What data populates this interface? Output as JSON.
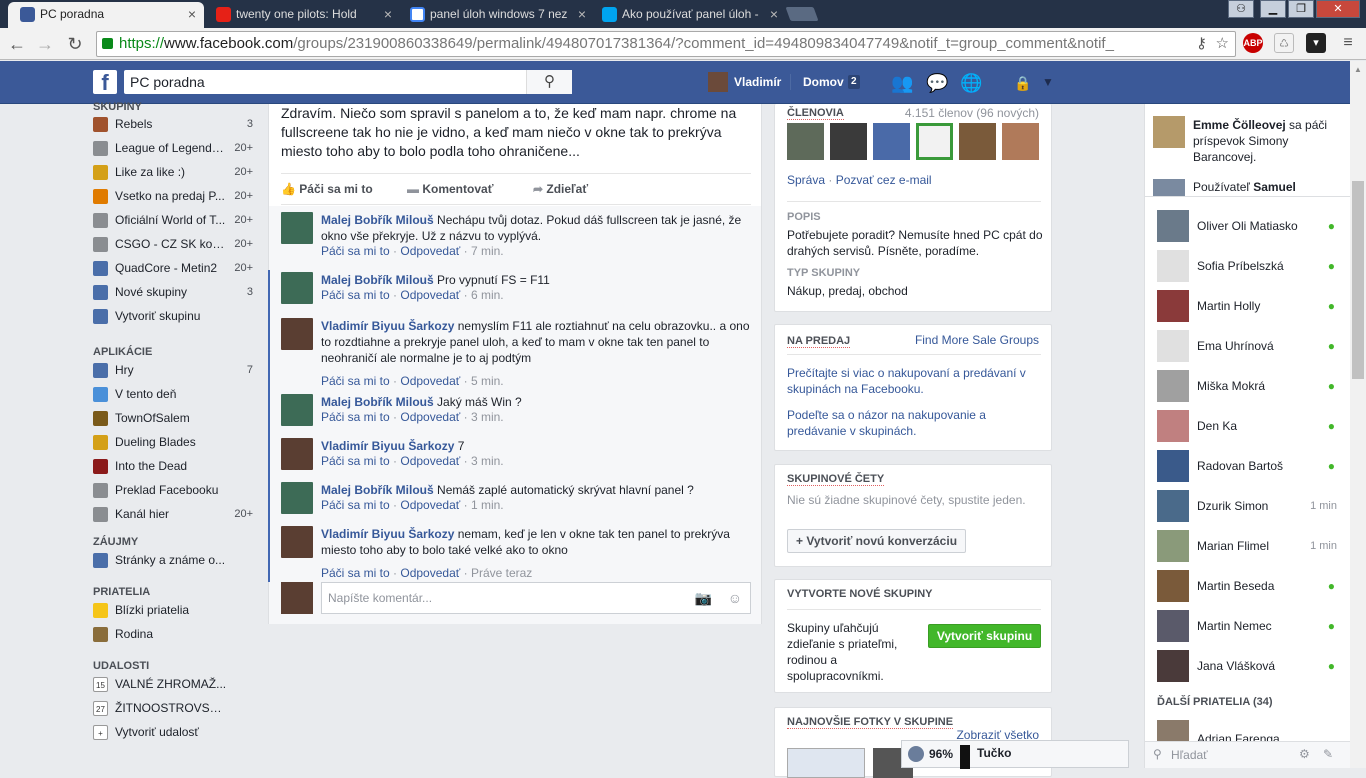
{
  "browser": {
    "tabs": [
      {
        "title": "PC poradna",
        "color": "#3b5998"
      },
      {
        "title": "twenty one pilots: Hold",
        "color": "#e62117"
      },
      {
        "title": "panel úloh windows 7 nez",
        "color": "#4285f4"
      },
      {
        "title": "Ako používať panel úloh -",
        "color": "#00a4ef"
      }
    ],
    "url_https": "https://",
    "url_host": "www.facebook.com",
    "url_rest": "/groups/231900860338649/permalink/494807017381364/?comment_id=494809834047749&notif_t=group_comment&notif_"
  },
  "fb": {
    "search_value": "PC poradna",
    "user": "Vladimír",
    "home": "Domov",
    "home_count": "2"
  },
  "left": {
    "groups_header": "SKUPINY",
    "groups": [
      {
        "label": "Rebels",
        "count": "3",
        "color": "#a0522d"
      },
      {
        "label": "League of Legends...",
        "count": "20+",
        "color": "#8a8d91"
      },
      {
        "label": "Like za like :)",
        "count": "20+",
        "color": "#d4a017"
      },
      {
        "label": "Vsetko na predaj P...",
        "count": "20+",
        "color": "#e07b00"
      },
      {
        "label": "Oficiální World of T...",
        "count": "20+",
        "color": "#8a8d91"
      },
      {
        "label": "CSGO - CZ SK kom...",
        "count": "20+",
        "color": "#8a8d91"
      },
      {
        "label": "QuadCore - Metin2",
        "count": "20+",
        "color": "#4a6ea9"
      },
      {
        "label": "Nové skupiny",
        "count": "3",
        "color": "#4a6ea9"
      },
      {
        "label": "Vytvoriť skupinu",
        "count": "",
        "color": "#4a6ea9"
      }
    ],
    "apps_header": "APLIKÁCIE",
    "apps": [
      {
        "label": "Hry",
        "count": "7",
        "color": "#4a6ea9"
      },
      {
        "label": "V tento deň",
        "count": "",
        "color": "#4a90d9"
      },
      {
        "label": "TownOfSalem",
        "count": "",
        "color": "#7a5a1a"
      },
      {
        "label": "Dueling Blades",
        "count": "",
        "color": "#d4a017"
      },
      {
        "label": "Into the Dead",
        "count": "",
        "color": "#8b1a1a"
      },
      {
        "label": "Preklad Facebooku",
        "count": "",
        "color": "#8a8d91"
      },
      {
        "label": "Kanál hier",
        "count": "20+",
        "color": "#8a8d91"
      }
    ],
    "interests_header": "ZÁUJMY",
    "interests": [
      {
        "label": "Stránky a známe o...",
        "count": "",
        "color": "#4a6ea9"
      }
    ],
    "friends_header": "PRIATELIA",
    "friends": [
      {
        "label": "Blízki priatelia",
        "count": "",
        "color": "#f5c518"
      },
      {
        "label": "Rodina",
        "count": "",
        "color": "#8a6d3b"
      }
    ],
    "events_header": "UDALOSTI",
    "events": [
      {
        "label": "VALNÉ ZHROMAŽ...",
        "count": "",
        "color": "#ffffff",
        "day": "15"
      },
      {
        "label": "ŽITNOOSTROVSK...",
        "count": "",
        "color": "#ffffff",
        "day": "27"
      },
      {
        "label": "Vytvoriť udalosť",
        "count": "",
        "color": "#ffffff",
        "day": "+"
      }
    ]
  },
  "post": {
    "text": "Zdravím. Niečo som spravil s panelom a to, že keď mam napr. chrome na fullscreene tak ho nie je vidno, a keď mam niečo v okne tak to prekrýva miesto toho aby to bolo podla toho ohraničene...",
    "like": "Páči sa mi to",
    "comment": "Komentovať",
    "share": "Zdieľať"
  },
  "comments": [
    {
      "name": "Malej Bobřík Milouš",
      "text": "Nechápu tvůj dotaz. Pokud dáš fullscreen tak je jasné, že okno vše překryje. Už z názvu to vyplývá.",
      "time": "7 min.",
      "like": "Páči sa mi to",
      "reply": "Odpovedať"
    },
    {
      "name": "Malej Bobřík Milouš",
      "text": "Pro vypnutí FS = F11",
      "time": "6 min.",
      "like": "Páči sa mi to",
      "reply": "Odpovedať"
    },
    {
      "name": "Vladimír Biyuu Šarkozy",
      "text": "nemyslím F11 ale roztiahnuť na celu obrazovku.. a ono to rozdtiahne a prekryje panel uloh, a keď to mam v okne tak ten panel to neohraničí ale normalne je to aj podtým",
      "time": "5 min.",
      "like": "Páči sa mi to",
      "reply": "Odpovedať"
    },
    {
      "name": "Malej Bobřík Milouš",
      "text": "Jaký máš Win ?",
      "time": "3 min.",
      "like": "Páči sa mi to",
      "reply": "Odpovedať"
    },
    {
      "name": "Vladimír Biyuu Šarkozy",
      "text": "7",
      "time": "3 min.",
      "like": "Páči sa mi to",
      "reply": "Odpovedať"
    },
    {
      "name": "Malej Bobřík Milouš",
      "text": "Nemáš zaplé automatický skrývat hlavní panel ?",
      "time": "1 min.",
      "like": "Páči sa mi to",
      "reply": "Odpovedať"
    },
    {
      "name": "Vladimír Biyuu Šarkozy",
      "text": "nemam, keď je len v okne tak ten panel to prekrýva miesto toho aby to bolo také velké ako to okno",
      "time": "Práve teraz",
      "like": "Páči sa mi to",
      "reply": "Odpovedať"
    }
  ],
  "comment_placeholder": "Napíšte komentár...",
  "right": {
    "members_header": "ČLENOVIA",
    "members_count": "4.151 členov (96 nových)",
    "manage": "Správa",
    "invite": "Pozvať cez e-mail",
    "desc_header": "POPIS",
    "desc": "Potřebujete poradit? Nemusíte hned PC cpát do drahých servisů. Písněte, poradíme.",
    "type_header": "TYP SKUPINY",
    "type": "Nákup, predaj, obchod",
    "sale_header": "NA PREDAJ",
    "sale_link": "Find More Sale Groups",
    "sale_p1": "Prečítajte si viac o nakupovaní a predávaní v skupinách na Facebooku.",
    "sale_p2": "Podeľte sa o názor na nakupovanie a predávanie v skupinách.",
    "chats_header": "SKUPINOVÉ ČETY",
    "chats_text": "Nie sú žiadne skupinové čety, spustite jeden.",
    "chats_button": "+ Vytvoriť novú konverzáciu",
    "create_header": "VYTVORTE NOVÉ SKUPINY",
    "create_text": "Skupiny uľahčujú zdieľanie s priateľmi, rodinou a spolupracovníkmi.",
    "create_button": "Vytvoriť skupinu",
    "photos_header": "NAJNOVŠIE FOTKY V SKUPINE",
    "photos_link": "Zobraziť všetko"
  },
  "ticker": [
    {
      "name": "Emme Čölleovej",
      "text": " sa páči príspevok Simony Barancovej."
    },
    {
      "name": "Samuel",
      "text": "Používateľ "
    }
  ],
  "chat": {
    "people": [
      {
        "name": "Oliver Oli Matiasko",
        "time": ""
      },
      {
        "name": "Sofia Príbelszká",
        "time": ""
      },
      {
        "name": "Martin Holly",
        "time": ""
      },
      {
        "name": "Ema Uhrínová",
        "time": ""
      },
      {
        "name": "Miška Mokrá",
        "time": ""
      },
      {
        "name": "Den Ka",
        "time": ""
      },
      {
        "name": "Radovan Bartoš",
        "time": ""
      },
      {
        "name": "Dzurik Simon",
        "time": "1 min"
      },
      {
        "name": "Marian Flimel",
        "time": "1 min"
      },
      {
        "name": "Martin Beseda",
        "time": ""
      },
      {
        "name": "Martin Nemec",
        "time": ""
      },
      {
        "name": "Jana Vlášková",
        "time": ""
      }
    ],
    "more_header": "ĎALŠÍ PRIATELIA (34)",
    "more_first": "Adrian Farenga",
    "search_placeholder": "Hľadať"
  },
  "tooltip": {
    "zoom": "96%",
    "text": "Tučko"
  }
}
